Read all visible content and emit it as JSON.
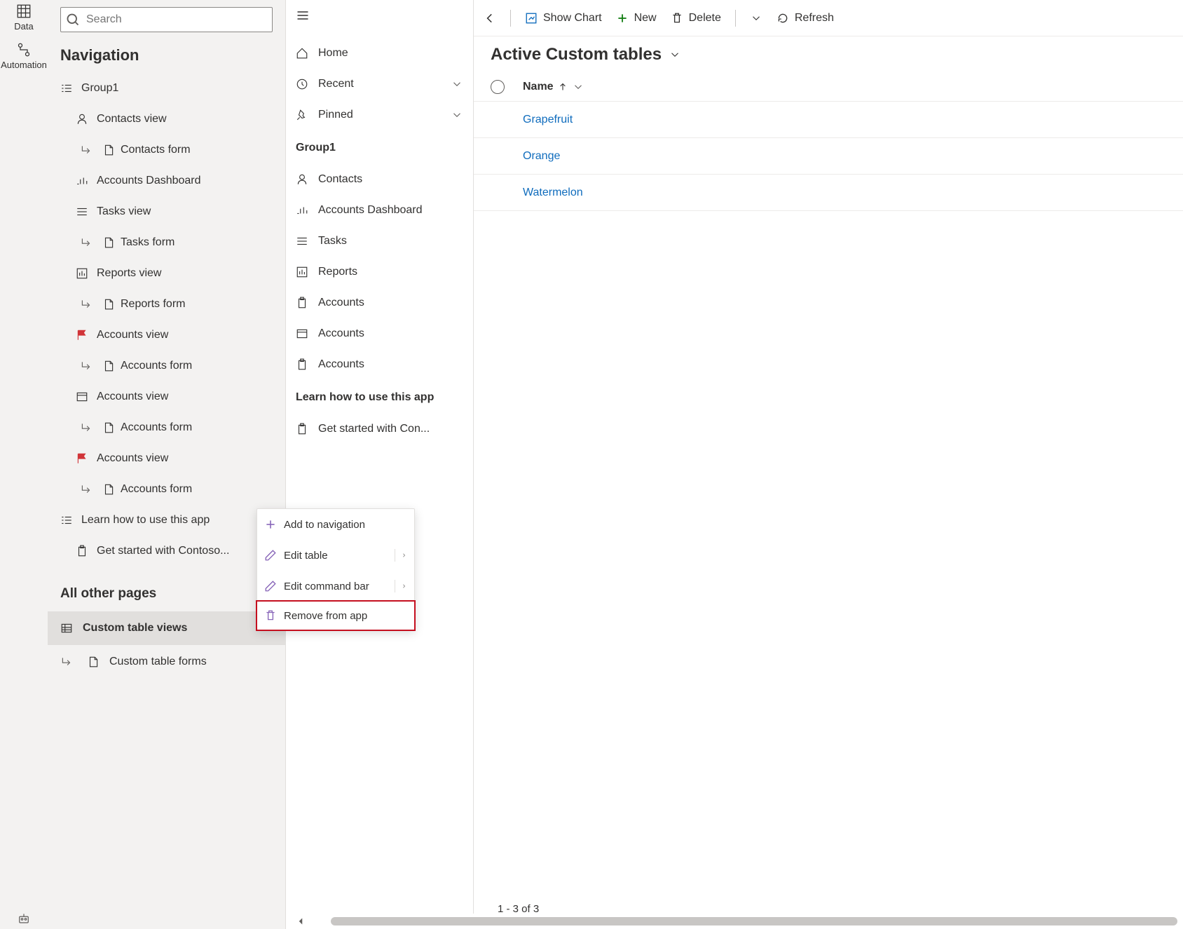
{
  "rail": {
    "data_label": "Data",
    "automation_label": "Automation"
  },
  "search": {
    "placeholder": "Search"
  },
  "nav": {
    "title": "Navigation",
    "group1_label": "Group1",
    "items": {
      "contacts_view": "Contacts view",
      "contacts_form": "Contacts form",
      "accounts_dashboard": "Accounts Dashboard",
      "tasks_view": "Tasks view",
      "tasks_form": "Tasks form",
      "reports_view": "Reports view",
      "reports_form": "Reports form",
      "accounts_view": "Accounts view",
      "accounts_form": "Accounts form"
    },
    "learn_group": "Learn how to use this app",
    "get_started": "Get started with Contoso...",
    "all_other_pages": "All other pages",
    "custom_table_views": "Custom table views",
    "custom_table_forms": "Custom table forms"
  },
  "app_nav": {
    "home": "Home",
    "recent": "Recent",
    "pinned": "Pinned",
    "group1": "Group1",
    "contacts": "Contacts",
    "accounts_dashboard": "Accounts Dashboard",
    "tasks": "Tasks",
    "reports": "Reports",
    "accounts": "Accounts",
    "learn_group": "Learn how to use this app",
    "get_started": "Get started with Con..."
  },
  "cmd": {
    "show_chart": "Show Chart",
    "new": "New",
    "delete": "Delete",
    "refresh": "Refresh"
  },
  "main": {
    "title": "Active Custom tables",
    "col_name": "Name",
    "rows": {
      "0": "Grapefruit",
      "1": "Orange",
      "2": "Watermelon"
    },
    "pager": "1 - 3 of 3"
  },
  "ctx": {
    "add_nav": "Add to navigation",
    "edit_table": "Edit table",
    "edit_cmd": "Edit command bar",
    "remove": "Remove from app"
  }
}
